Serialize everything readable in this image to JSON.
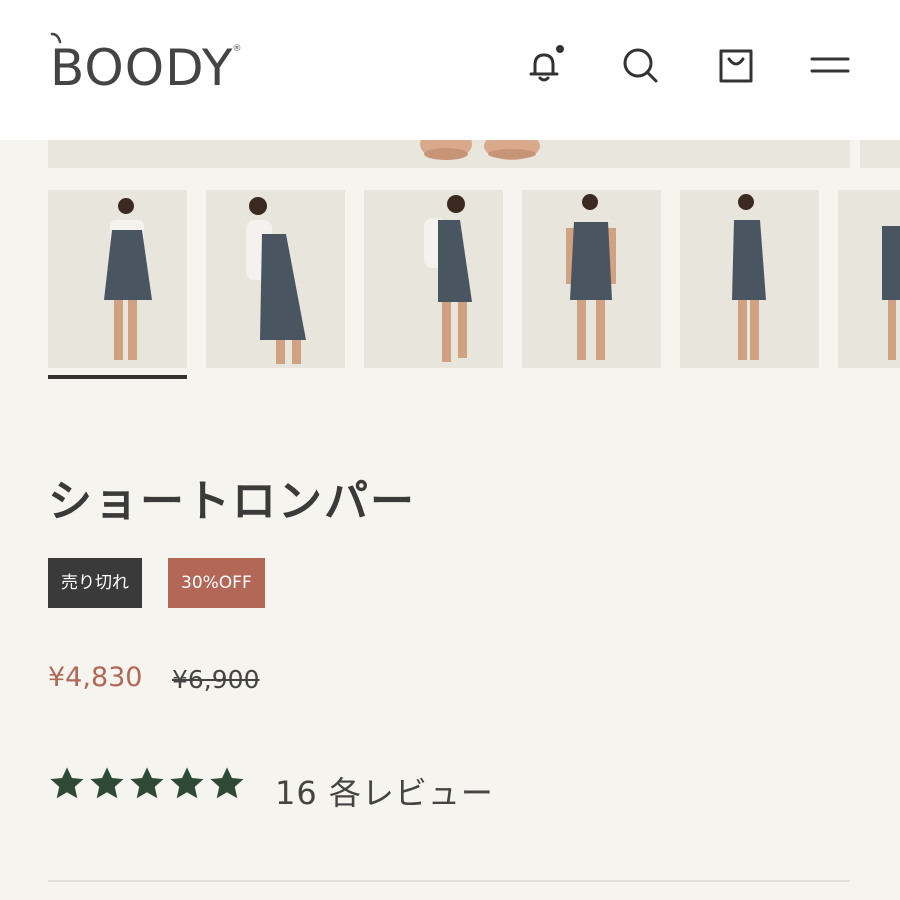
{
  "header": {
    "logo_text": "BOODY",
    "icons": [
      "bell-icon",
      "search-icon",
      "bag-icon",
      "menu-icon"
    ]
  },
  "product": {
    "title": "ショートロンパー",
    "badges": {
      "sold_out": "売り切れ",
      "discount": "30%OFF"
    },
    "price_sale": "¥4,830",
    "price_original": "¥6,900",
    "rating": 5,
    "reviews_label": "16 各レビュー"
  },
  "colors": {
    "accent": "#b26757",
    "dark_badge": "#3a3a3a",
    "star": "#2f4a34",
    "background": "#f5f4ef"
  }
}
